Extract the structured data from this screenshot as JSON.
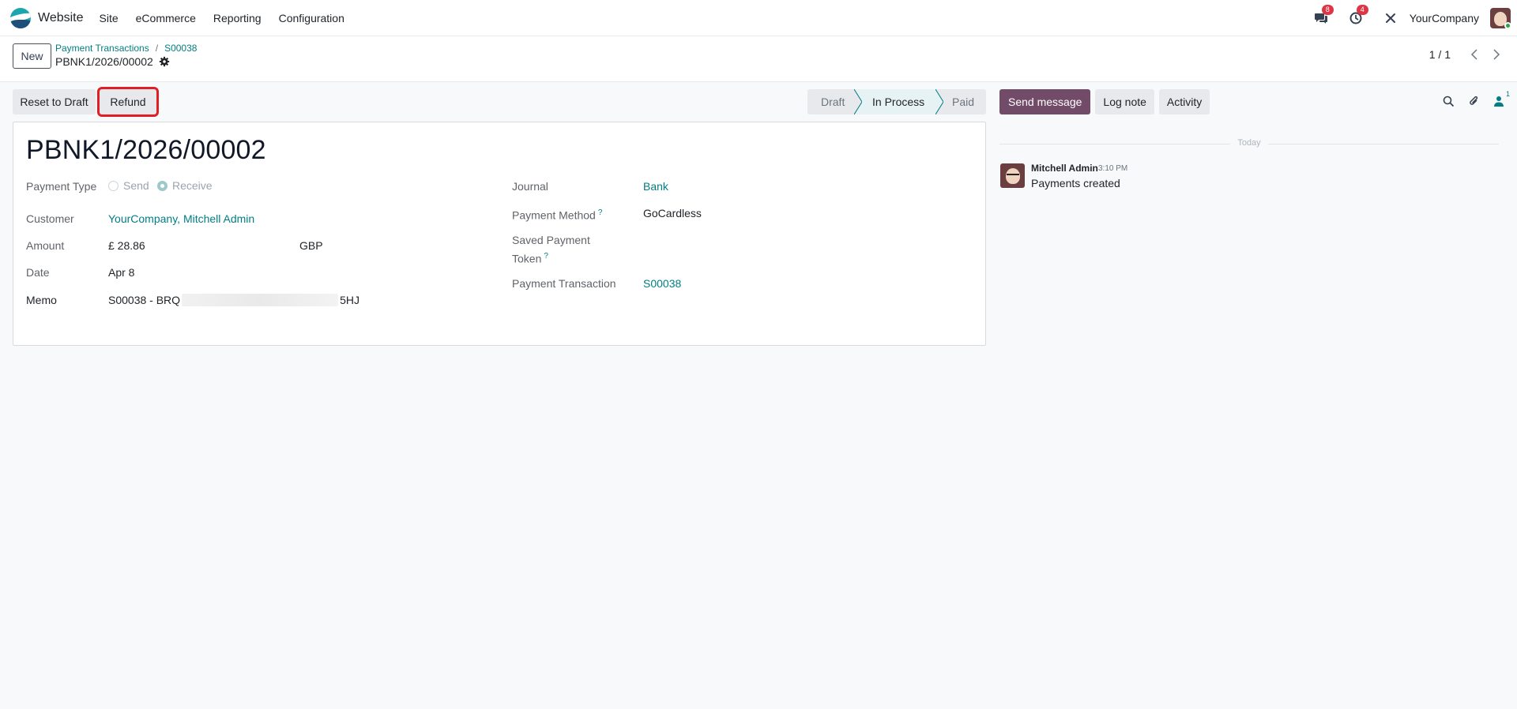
{
  "navbar": {
    "app_name": "Website",
    "menu": [
      "Site",
      "eCommerce",
      "Reporting",
      "Configuration"
    ],
    "messages_count": "8",
    "activities_count": "4",
    "company": "YourCompany"
  },
  "control_panel": {
    "new_label": "New",
    "breadcrumb": [
      "Payment Transactions",
      "S00038"
    ],
    "record_title": "PBNK1/2026/00002",
    "pager_value": "1 / 1"
  },
  "actions": {
    "reset_label": "Reset to Draft",
    "refund_label": "Refund"
  },
  "statusbar": {
    "stages": [
      "Draft",
      "In Process",
      "Paid"
    ],
    "current": "In Process"
  },
  "form": {
    "name": "PBNK1/2026/00002",
    "payment_type_label": "Payment Type",
    "payment_type_options": [
      "Send",
      "Receive"
    ],
    "payment_type_selected": "Receive",
    "customer_label": "Customer",
    "customer_value": "YourCompany, Mitchell Admin",
    "amount_label": "Amount",
    "amount_value": "£ 28.86",
    "currency": "GBP",
    "date_label": "Date",
    "date_value": "Apr 8",
    "memo_label": "Memo",
    "memo_prefix": "S00038 - BRQ",
    "memo_suffix": "5HJ",
    "journal_label": "Journal",
    "journal_value": "Bank",
    "payment_method_label": "Payment Method",
    "payment_method_value": "GoCardless",
    "saved_token_label_1": "Saved Payment",
    "saved_token_label_2": "Token",
    "payment_transaction_label": "Payment Transaction",
    "payment_transaction_value": "S00038",
    "help_mark": "?"
  },
  "chatter": {
    "send_message": "Send message",
    "log_note": "Log note",
    "activity": "Activity",
    "followers_count": "1",
    "date_separator": "Today",
    "message": {
      "author": "Mitchell Admin",
      "time": "3:10 PM",
      "body": "Payments created"
    }
  },
  "colors": {
    "accent": "#017e84",
    "primary": "#714b67",
    "highlight_box": "#e11d25"
  }
}
